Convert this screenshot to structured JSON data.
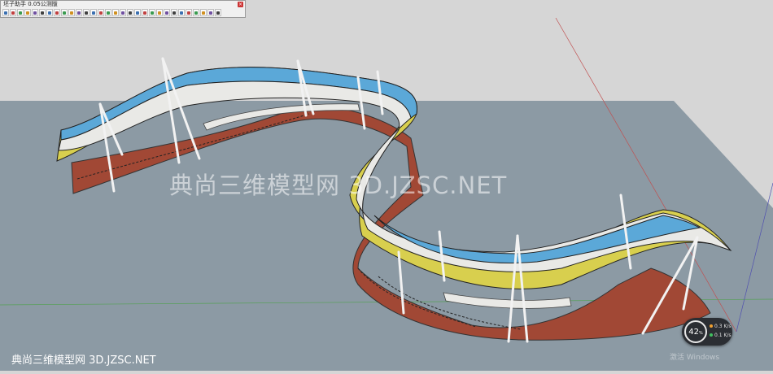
{
  "plugin": {
    "title": "坯子助手 0.05公测版",
    "close_label": "×",
    "tools": [
      "select-tool",
      "rotate-tool",
      "orbit-tool",
      "pan-tool",
      "zoom-tool",
      "grid-tool",
      "tape-tool",
      "arrow-tool",
      "line-tool",
      "scissors-tool",
      "pencil-tool",
      "edit-tool",
      "rectangle-tool",
      "component-tool",
      "flip-tool",
      "scale-tool",
      "curve-tool",
      "text-tool",
      "paint-tool",
      "layer-tool",
      "shadow-tool",
      "camera-tool",
      "walk-tool",
      "section-tool",
      "dimension-tool",
      "axes-tool",
      "group-tool",
      "explode-tool",
      "plugin-tool",
      "palette-tool"
    ]
  },
  "watermark": {
    "center": "典尚三维模型网 3D.JZSC.NET",
    "bottom": "典尚三维模型网 3D.JZSC.NET"
  },
  "os_overlay": {
    "activate": "激活 Windows"
  },
  "performance": {
    "percent": "42",
    "percent_unit": "%",
    "upload": "0.3",
    "download": "0.1",
    "rate_unit": "K/s"
  },
  "colors": {
    "sky": "#d6d6d6",
    "ground": "#8c9aa4",
    "blue_band": "#5ba8d8",
    "yellow_band": "#d8cf4e",
    "white_band": "#e9e9e6",
    "red_path": "#a14835"
  }
}
